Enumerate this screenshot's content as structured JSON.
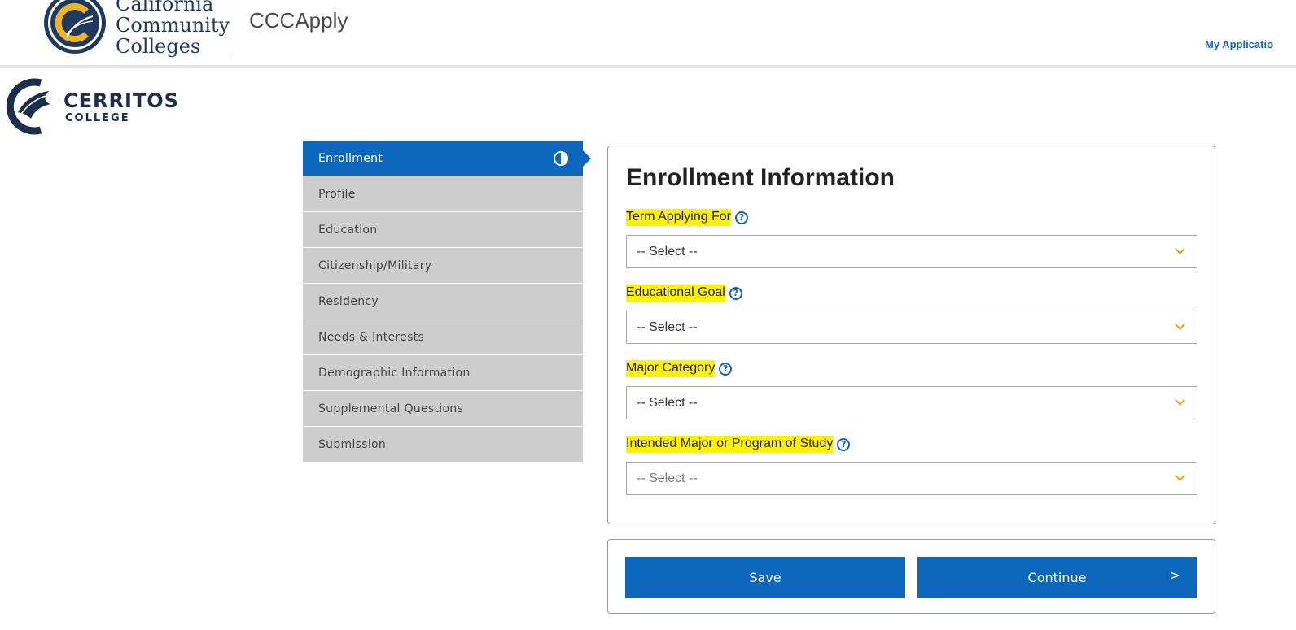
{
  "header": {
    "org_name_lines": [
      "California",
      "Community",
      "Colleges"
    ],
    "app_name": "CCCApply",
    "my_applications": "My Applicatio"
  },
  "college": {
    "name": "CERRITOS",
    "subtitle": "COLLEGE"
  },
  "nav": {
    "items": [
      {
        "label": "Enrollment"
      },
      {
        "label": "Profile"
      },
      {
        "label": "Education"
      },
      {
        "label": "Citizenship/Military"
      },
      {
        "label": "Residency"
      },
      {
        "label": "Needs & Interests"
      },
      {
        "label": "Demographic Information"
      },
      {
        "label": "Supplemental Questions"
      },
      {
        "label": "Submission"
      }
    ],
    "active_index": 0
  },
  "form": {
    "title": "Enrollment Information",
    "fields": [
      {
        "label": "Term Applying For",
        "value": "-- Select --"
      },
      {
        "label": "Educational Goal",
        "value": "-- Select --"
      },
      {
        "label": "Major Category",
        "value": "-- Select --"
      },
      {
        "label": "Intended Major or Program of Study",
        "value": "-- Select --"
      }
    ]
  },
  "actions": {
    "save_label": "Save",
    "continue_label": "Continue",
    "continue_arrow": ">"
  },
  "colors": {
    "primary": "#0d67bd",
    "nav_inactive": "#cdcdcd",
    "highlight": "#fff200",
    "chevron": "#e3a812",
    "link": "#1565b5"
  },
  "icons": {
    "help": "?",
    "progress": "half-circle-icon"
  }
}
